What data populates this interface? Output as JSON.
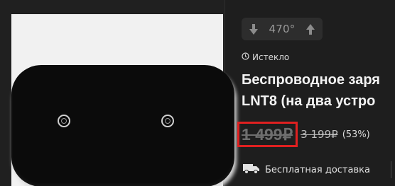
{
  "rating": {
    "value": "470°",
    "down_icon": "arrow-down-icon",
    "up_icon": "arrow-up-icon"
  },
  "status": {
    "icon": "clock-icon",
    "label": "Истекло"
  },
  "product": {
    "title": "Беспроводное заря\nLNT8 (на два устро"
  },
  "price": {
    "current": "1 499₽",
    "old": "3 199₽",
    "discount": "(53%)",
    "highlight_color": "#e02020"
  },
  "delivery": {
    "icon": "truck-icon",
    "label": "Бесплатная доставка"
  }
}
